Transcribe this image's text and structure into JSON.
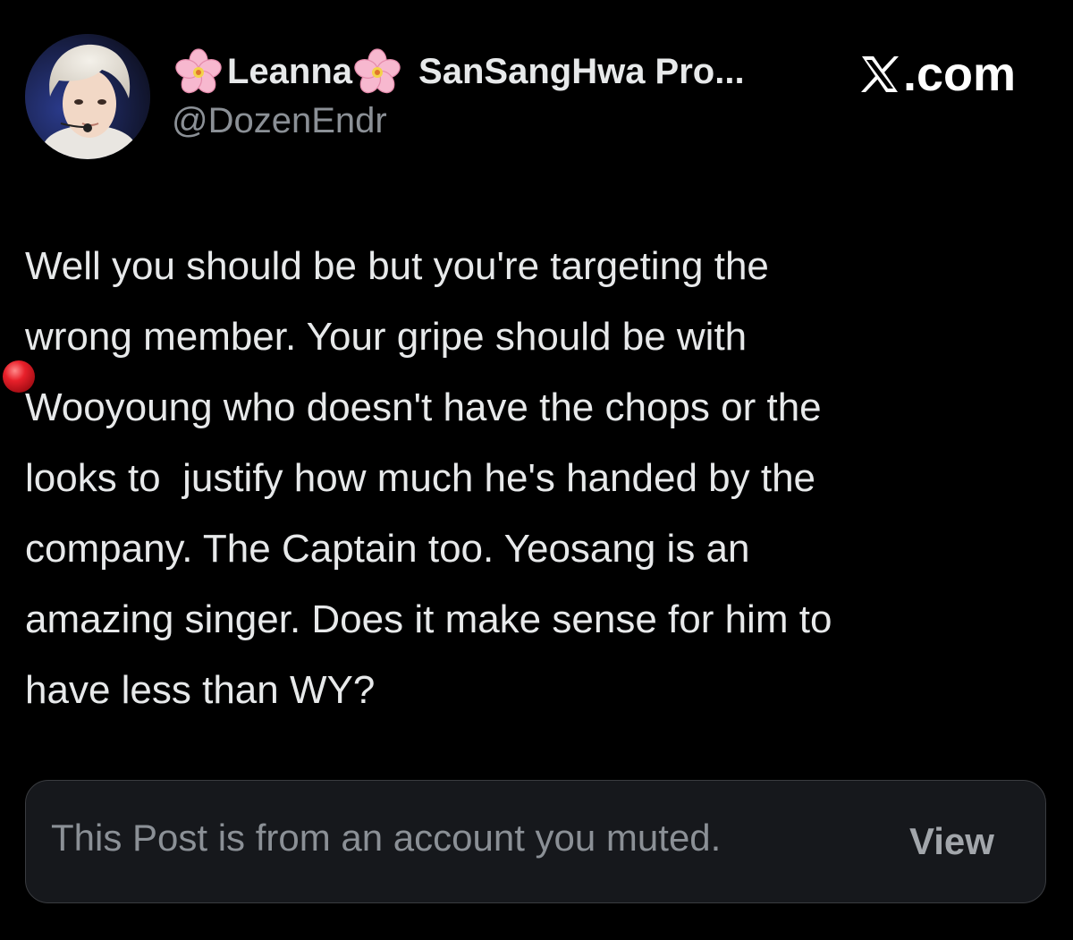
{
  "author": {
    "display_name": "Leanna",
    "display_name_suffix": "SanSangHwa Pro...",
    "handle": "@DozenEndr",
    "avatar_icon": "avatar-photo",
    "name_emoji": "cherry-blossom-icon"
  },
  "site": {
    "logo_icon": "x-logo-icon",
    "label": ".com"
  },
  "post": {
    "lines": [
      "Well you should be but you're targeting the",
      "wrong member. Your gripe should be with",
      "Wooyoung who doesn't have the chops or the",
      "looks to  justify how much he's handed by the",
      "company. The Captain too. Yeosang is an",
      "amazing singer. Does it make sense for him to",
      "have less than WY?"
    ]
  },
  "muted_notice": {
    "text": "This Post is from an account you muted.",
    "view_label": "View"
  },
  "colors": {
    "background": "#000000",
    "text_primary": "#e7e9ea",
    "text_secondary": "#8b9096",
    "box_background": "#16181c",
    "box_border": "#3a3c40",
    "marker": "#e8202a"
  }
}
